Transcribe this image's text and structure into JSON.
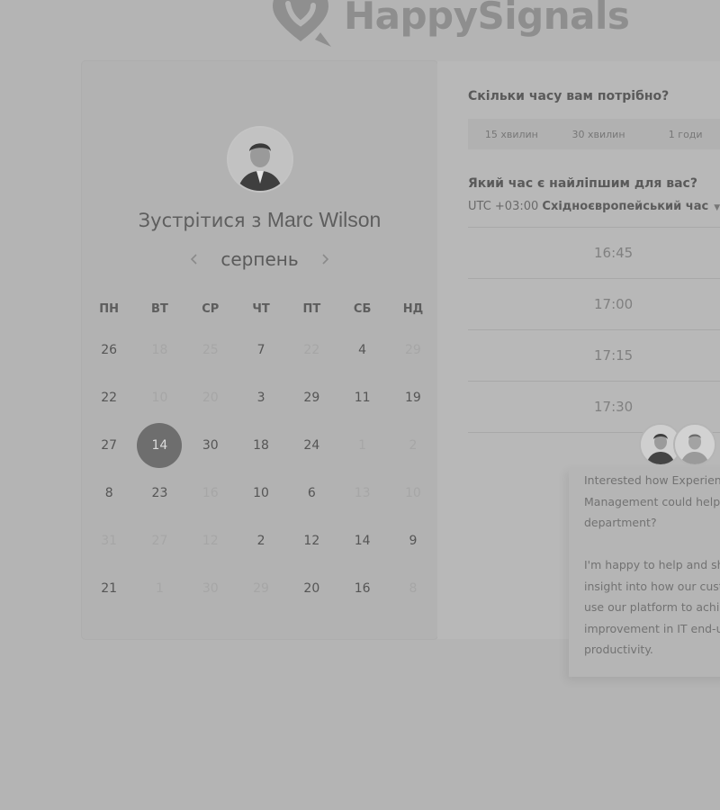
{
  "brand": {
    "name": "HappySignals"
  },
  "meeting": {
    "prefix": "Зустрітися з",
    "host": "Marc Wilson"
  },
  "calendar": {
    "month": "серпень",
    "prev_icon": "chevron-left-icon",
    "next_icon": "chevron-right-icon",
    "weekdays": [
      "ПН",
      "ВТ",
      "СР",
      "ЧТ",
      "ПТ",
      "СБ",
      "НД"
    ],
    "days": [
      {
        "label": "26",
        "available": true
      },
      {
        "label": "18",
        "available": false
      },
      {
        "label": "25",
        "available": false
      },
      {
        "label": "7",
        "available": true
      },
      {
        "label": "22",
        "available": false
      },
      {
        "label": "4",
        "available": true
      },
      {
        "label": "29",
        "available": false
      },
      {
        "label": "22",
        "available": true
      },
      {
        "label": "10",
        "available": false
      },
      {
        "label": "20",
        "available": false
      },
      {
        "label": "3",
        "available": true
      },
      {
        "label": "29",
        "available": true
      },
      {
        "label": "11",
        "available": true
      },
      {
        "label": "19",
        "available": true
      },
      {
        "label": "27",
        "available": true
      },
      {
        "label": "14",
        "available": true,
        "selected": true
      },
      {
        "label": "30",
        "available": true
      },
      {
        "label": "18",
        "available": true
      },
      {
        "label": "24",
        "available": true
      },
      {
        "label": "1",
        "available": false
      },
      {
        "label": "2",
        "available": false
      },
      {
        "label": "8",
        "available": true
      },
      {
        "label": "23",
        "available": true
      },
      {
        "label": "16",
        "available": false
      },
      {
        "label": "10",
        "available": true
      },
      {
        "label": "6",
        "available": true
      },
      {
        "label": "13",
        "available": false
      },
      {
        "label": "10",
        "available": false
      },
      {
        "label": "31",
        "available": false
      },
      {
        "label": "27",
        "available": false
      },
      {
        "label": "12",
        "available": false
      },
      {
        "label": "2",
        "available": true
      },
      {
        "label": "12",
        "available": true
      },
      {
        "label": "14",
        "available": true
      },
      {
        "label": "9",
        "available": true
      },
      {
        "label": "21",
        "available": true
      },
      {
        "label": "1",
        "available": false
      },
      {
        "label": "30",
        "available": false
      },
      {
        "label": "29",
        "available": false
      },
      {
        "label": "20",
        "available": true
      },
      {
        "label": "16",
        "available": true
      },
      {
        "label": "8",
        "available": false
      }
    ]
  },
  "duration": {
    "question": "Скільки часу вам потрібно?",
    "options": [
      "15 хвилин",
      "30 хвилин",
      "1 годи"
    ]
  },
  "time": {
    "question": "Який час є найліпшим для вас?",
    "timezone_offset": "UTC +03:00",
    "timezone_name": "Східноєвропейський час",
    "slots": [
      "16:45",
      "17:00",
      "17:15",
      "17:30"
    ]
  },
  "chat": {
    "paragraph1": [
      "Interested how Experien",
      "Management could help",
      "department?"
    ],
    "paragraph2": [
      "I'm happy to help and sh",
      "insight into how our custo",
      "use our platform to achie",
      "improvement in IT end-u",
      "productivity."
    ]
  },
  "colors": {
    "background": "#b4b4b4",
    "selected_day": "#6e6e6e",
    "text_primary": "#5a5a5a",
    "text_dim": "#a6a6a6"
  }
}
